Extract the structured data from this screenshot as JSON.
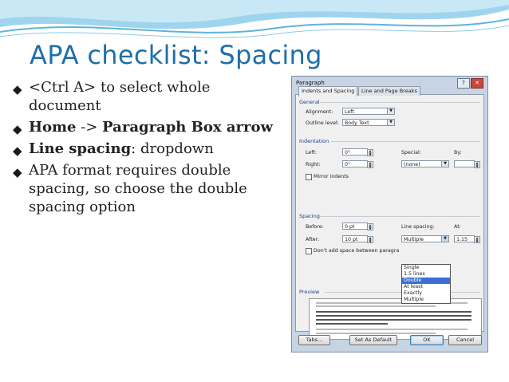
{
  "slide": {
    "title": "APA checklist: Spacing",
    "bullets": [
      {
        "pre": "",
        "bold": "",
        "text": "<Ctrl A> to select whole document"
      },
      {
        "pre": "",
        "bold": "Home",
        "mid": " -> ",
        "bold2": "Paragraph Box arrow",
        "text": ""
      },
      {
        "pre": "",
        "bold": "Line spacing",
        "text": ": dropdown"
      },
      {
        "pre": "",
        "bold": "",
        "text": "APA format requires double spacing, so choose the double spacing option"
      }
    ]
  },
  "dialog": {
    "caption": "Paragraph",
    "help_glyph": "?",
    "close_glyph": "✕",
    "tabs": [
      "Indents and Spacing",
      "Line and Page Breaks"
    ],
    "general": {
      "heading": "General",
      "alignment_label": "Alignment:",
      "alignment_value": "Left",
      "outline_label": "Outline level:",
      "outline_value": "Body Text"
    },
    "indentation": {
      "heading": "Indentation",
      "left_label": "Left:",
      "left_value": "0\"",
      "right_label": "Right:",
      "right_value": "0\"",
      "special_label": "Special:",
      "special_value": "(none)",
      "by_label": "By:",
      "mirror_label": "Mirror indents"
    },
    "spacing": {
      "heading": "Spacing",
      "before_label": "Before:",
      "before_value": "0 pt",
      "after_label": "After:",
      "after_value": "10 pt",
      "line_spacing_label": "Line spacing:",
      "line_spacing_value": "Multiple",
      "at_label": "At:",
      "at_value": "1.15",
      "dont_add_label": "Don't add space between paragra",
      "options": [
        "Single",
        "1.5 lines",
        "Double",
        "At least",
        "Exactly",
        "Multiple"
      ],
      "highlighted_option": "Double"
    },
    "preview_heading": "Preview",
    "buttons": {
      "tabs": "Tabs...",
      "set_default": "Set As Default",
      "ok": "OK",
      "cancel": "Cancel"
    }
  },
  "colors": {
    "title": "#1f6fa8",
    "accent_wave": "#5fb2dc",
    "selection": "#3a6fd8"
  }
}
